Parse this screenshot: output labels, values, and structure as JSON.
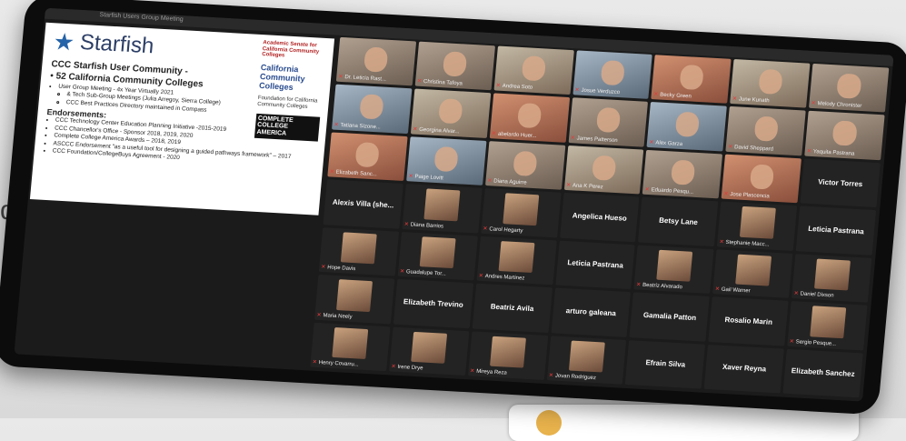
{
  "background": {
    "partial_letter": "d"
  },
  "window": {
    "title": "Starfish Users Group Meeting"
  },
  "slide": {
    "brand": "Starfish",
    "logos": [
      "Academic Senate for California Community Colleges",
      "California Community Colleges",
      "Foundation for California Community Colleges",
      "COMPLETE COLLEGE AMERICA"
    ],
    "heading": "CCC Starfish User Community -",
    "subheading": "• 52 California Community Colleges",
    "bullets": [
      "User Group Meeting - 4x Year Virtually 2021",
      "& Tech Sub-Group Meetings (Julia Arregoy, Sierra College)",
      "CCC Best Practices Directory maintained in Compass"
    ],
    "endorsements_title": "Endorsements:",
    "endorsements": [
      "CCC Technology Center Education Planning Initiative -2015-2019",
      "CCC Chancellor's Office - Sponsor 2018, 2019, 2020",
      "Complete College America Awards – 2018, 2019",
      "ASCCC Endorsement \"as a useful tool for designing a guided pathways framework\" – 2017",
      "CCC Foundation/CollegeBuys Agreement - 2020"
    ]
  },
  "participants": [
    {
      "name": "Dr. Leticia Rast...",
      "type": "video"
    },
    {
      "name": "Christina Tafoya",
      "type": "video"
    },
    {
      "name": "Andrea Soto",
      "type": "video"
    },
    {
      "name": "Josue Verduzco",
      "type": "video"
    },
    {
      "name": "Becky Green",
      "type": "video"
    },
    {
      "name": "June Kunath",
      "type": "video"
    },
    {
      "name": "Melody Chronister",
      "type": "video"
    },
    {
      "name": "Tatiana Sizone...",
      "type": "video"
    },
    {
      "name": "Georgina Alvar...",
      "type": "video"
    },
    {
      "name": "abelardo Huer...",
      "type": "video"
    },
    {
      "name": "James Patterson",
      "type": "video"
    },
    {
      "name": "Alex Garza",
      "type": "video"
    },
    {
      "name": "David Sheppard",
      "type": "video"
    },
    {
      "name": "Yaquita Pastrana",
      "type": "video"
    },
    {
      "name": "Elizabeth Sanc...",
      "type": "video"
    },
    {
      "name": "Paige Lovitt",
      "type": "video"
    },
    {
      "name": "Diana Aguirre",
      "type": "video"
    },
    {
      "name": "Ana K Perez",
      "type": "video"
    },
    {
      "name": "Eduardo Pesqu...",
      "type": "video"
    },
    {
      "name": "Jose Plascencia",
      "type": "video"
    },
    {
      "name": "Victor Torres",
      "type": "name-only"
    },
    {
      "name": "Alexis Villa (she...",
      "type": "name-only"
    },
    {
      "name": "Diana Barrios",
      "type": "avatar"
    },
    {
      "name": "Carol Hegarty",
      "type": "avatar"
    },
    {
      "name": "Angelica Hueso",
      "type": "name-only"
    },
    {
      "name": "Betsy Lane",
      "type": "name-only"
    },
    {
      "name": "Stephanie Macc...",
      "type": "avatar"
    },
    {
      "name": "Leticia Pastrana",
      "type": "name-only"
    },
    {
      "name": "Hope Davis",
      "type": "avatar"
    },
    {
      "name": "Guadalupe Tor...",
      "type": "avatar"
    },
    {
      "name": "Andres Martinez",
      "type": "avatar"
    },
    {
      "name": "Leticia Pastrana",
      "type": "name-only"
    },
    {
      "name": "Beatriz Alvarado",
      "type": "avatar"
    },
    {
      "name": "Gail Warner",
      "type": "avatar"
    },
    {
      "name": "Daniel Dixson",
      "type": "avatar"
    },
    {
      "name": "Maria Neely",
      "type": "avatar"
    },
    {
      "name": "Elizabeth Trevino",
      "type": "name-only"
    },
    {
      "name": "Beatriz Avila",
      "type": "name-only"
    },
    {
      "name": "arturo galeana",
      "type": "name-only"
    },
    {
      "name": "Gamalia Patton",
      "type": "name-only"
    },
    {
      "name": "Rosalio Marin",
      "type": "name-only"
    },
    {
      "name": "Sergio Pesque...",
      "type": "avatar"
    },
    {
      "name": "Henry Covarru...",
      "type": "avatar"
    },
    {
      "name": "Irene Drye",
      "type": "avatar"
    },
    {
      "name": "Mireya Reza",
      "type": "avatar"
    },
    {
      "name": "Jovan Rodriguez",
      "type": "avatar"
    },
    {
      "name": "Efrain Silva",
      "type": "name-only"
    },
    {
      "name": "Xaver Reyna",
      "type": "name-only"
    },
    {
      "name": "Elizabeth Sanchez",
      "type": "name-only"
    }
  ]
}
